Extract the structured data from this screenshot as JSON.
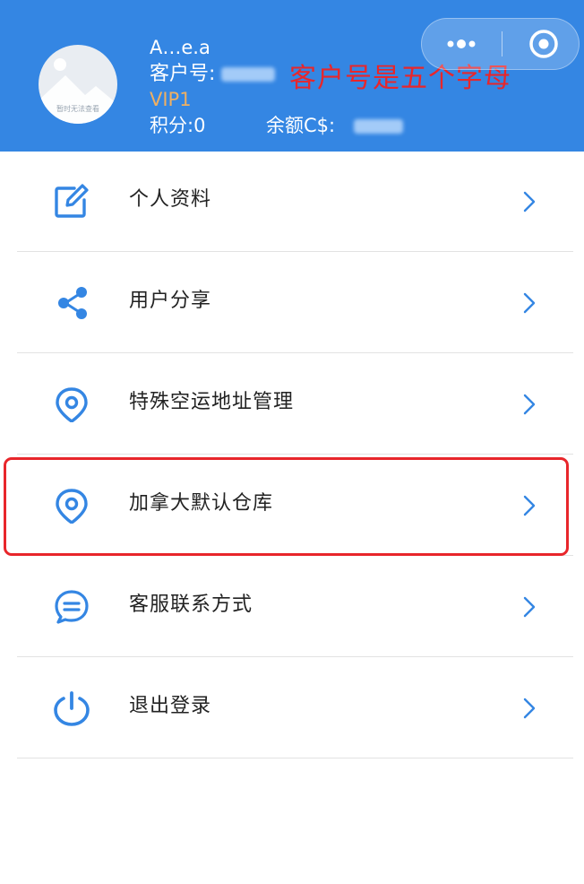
{
  "colors": {
    "header_bg": "#3486e3",
    "accent": "#3486e3",
    "vip": "#efb063",
    "annotation": "#e8262b"
  },
  "profile": {
    "avatar_caption": "暂时无法查看",
    "username": "A…e.a",
    "customer_id_label": "客户号:",
    "vip_level": "VIP1",
    "points": "积分:0",
    "balance_label": "余额C$:"
  },
  "annotation": {
    "text": "客户号是五个字母"
  },
  "capsule": {
    "more_icon": "more-dots-icon",
    "close_icon": "target-circle-icon"
  },
  "menu": {
    "items": [
      {
        "label": "个人资料",
        "icon": "edit-icon"
      },
      {
        "label": "用户分享",
        "icon": "share-icon"
      },
      {
        "label": "特殊空运地址管理",
        "icon": "location-pin-icon"
      },
      {
        "label": "加拿大默认仓库",
        "icon": "location-pin-icon"
      },
      {
        "label": "客服联系方式",
        "icon": "chat-bubble-icon"
      },
      {
        "label": "退出登录",
        "icon": "power-icon"
      }
    ]
  }
}
